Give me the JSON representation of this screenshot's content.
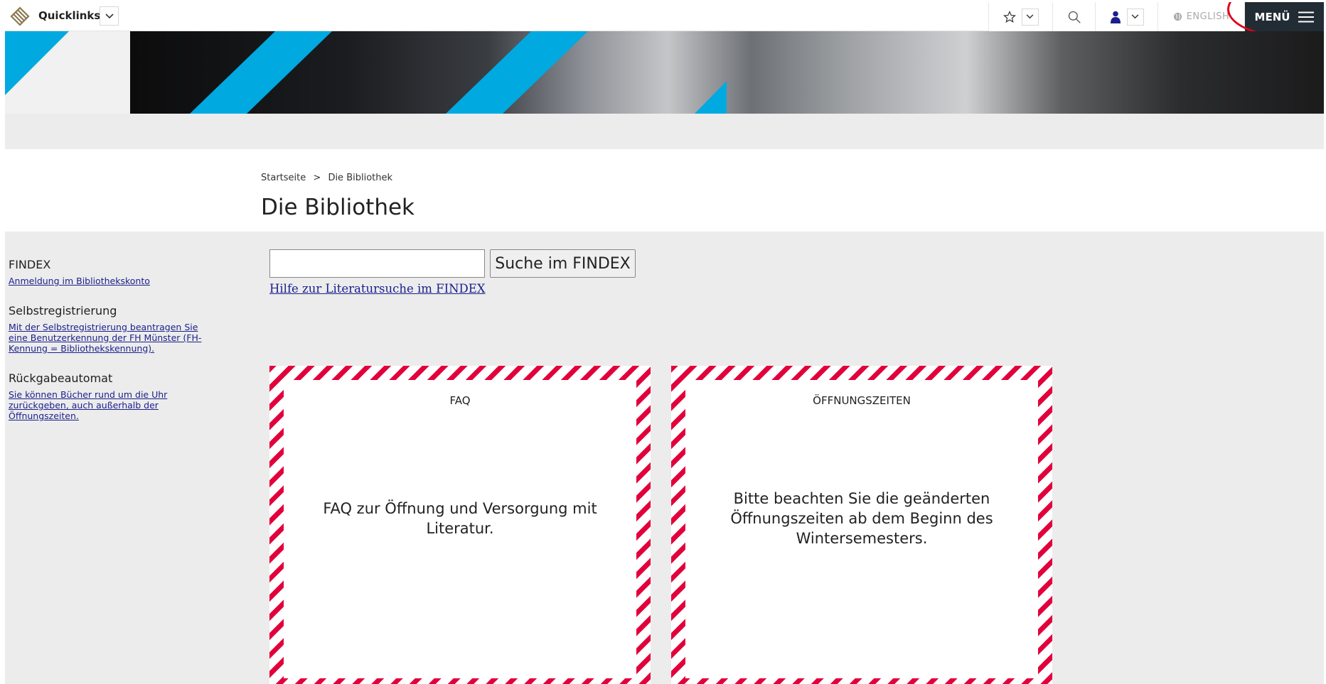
{
  "topbar": {
    "quicklinks_label": "Quicklinks",
    "language_label": "ENGLISH",
    "menu_label": "MENÜ"
  },
  "breadcrumb": {
    "home": "Startseite",
    "separator": ">",
    "current": "Die Bibliothek"
  },
  "page_title": "Die Bibliothek",
  "sidebar": {
    "sections": [
      {
        "heading": "FINDEX",
        "link": "Anmeldung im Bibliothekskonto"
      },
      {
        "heading": "Selbstregistrierung",
        "link": "Mit der Selbstregistrierung beantragen Sie eine Benutzerkennung der FH Münster (FH-Kennung = Bibliothekskennung)."
      },
      {
        "heading": "Rückgabeautomat",
        "link": "Sie können Bücher rund um die Uhr zurückgeben, auch außerhalb der Öffnungszeiten."
      }
    ]
  },
  "search": {
    "input_value": "",
    "button_label": "Suche im FINDEX",
    "help_link": "Hilfe zur Literatursuche im FINDEX"
  },
  "cards": [
    {
      "title": "FAQ",
      "text": "FAQ zur Öffnung und Versorgung mit Literatur."
    },
    {
      "title": "ÖFFNUNGSZEITEN",
      "text": "Bitte beachten Sie die geänderten Öffnungszeiten ab dem Beginn des Wintersemesters."
    }
  ],
  "colors": {
    "accent_cyan": "#00a9e0",
    "stripe_red": "#e2003c",
    "link_blue": "#1a1f8c",
    "menu_dark": "#222c35",
    "annotation_red": "#e0001a"
  }
}
